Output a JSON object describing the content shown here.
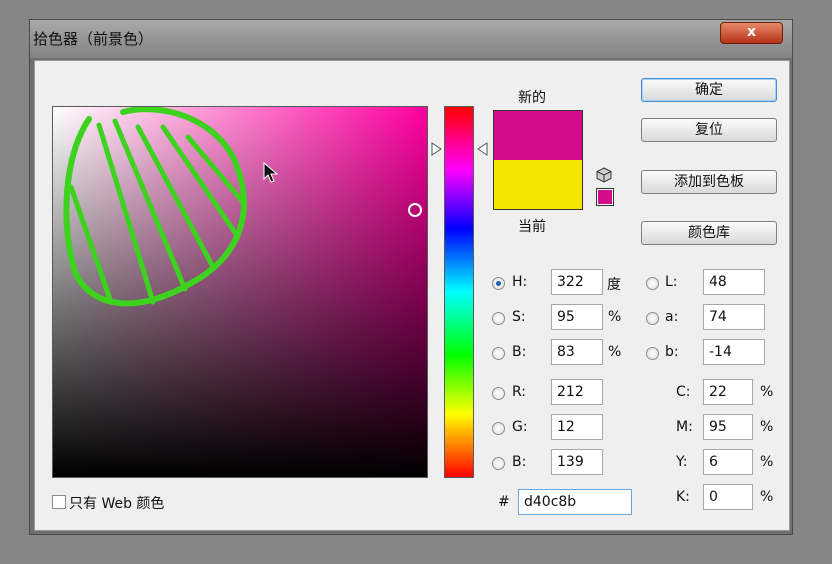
{
  "window": {
    "title": "拾色器（前景色）",
    "close_label": "x"
  },
  "preview": {
    "new_label": "新的",
    "current_label": "当前",
    "new_color": "#d40c8b",
    "current_color": "#f5e600"
  },
  "field": {
    "pure_hue_color": "#ff00a0"
  },
  "buttons": {
    "ok": "确定",
    "reset": "复位",
    "add_to_swatches": "添加到色板",
    "color_libraries": "颜色库"
  },
  "hsb": {
    "h_label": "H:",
    "h_value": "322",
    "h_unit": "度",
    "s_label": "S:",
    "s_value": "95",
    "s_unit": "%",
    "b_label": "B:",
    "b_value": "83",
    "b_unit": "%",
    "selected": "H"
  },
  "lab": {
    "l_label": "L:",
    "l_value": "48",
    "a_label": "a:",
    "a_value": "74",
    "b_label": "b:",
    "b_value": "-14"
  },
  "rgb": {
    "r_label": "R:",
    "r_value": "212",
    "g_label": "G:",
    "g_value": "12",
    "b_label": "B:",
    "b_value": "139"
  },
  "cmyk": {
    "c_label": "C:",
    "c_value": "22",
    "m_label": "M:",
    "m_value": "95",
    "y_label": "Y:",
    "y_value": "6",
    "k_label": "K:",
    "k_value": "0",
    "unit": "%"
  },
  "hex": {
    "hash_label": "#",
    "value": "d40c8b"
  },
  "web_only": {
    "label": "只有 Web 颜色",
    "checked": false
  },
  "icons": {
    "cube": "cube-icon",
    "cursor": "arrow-cursor-icon"
  }
}
